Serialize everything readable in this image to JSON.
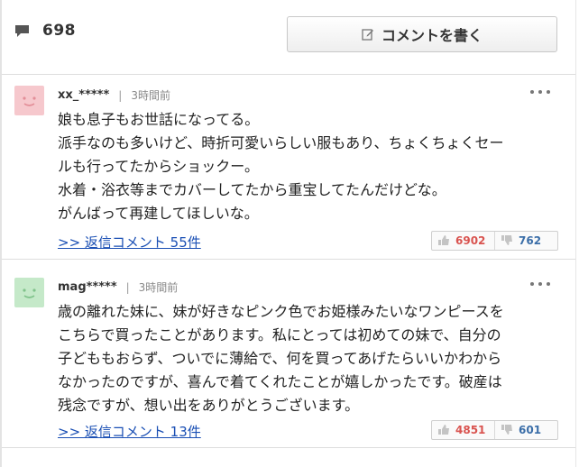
{
  "header": {
    "comment_count": "698",
    "write_button_label": "コメントを書く"
  },
  "comments": [
    {
      "user": "xx_*****",
      "separator": "|",
      "time": "3時間前",
      "avatar_color": "#f6c8cd",
      "lines": [
        "娘も息子もお世話になってる。",
        "派手なのも多いけど、時折可愛いらしい服もあり、ちょくちょくセー",
        "ルも行ってたからショックー。",
        "水着・浴衣等までカバーしてたから重宝してたんだけどな。",
        "がんばって再建してほしいな。"
      ],
      "reply_link": ">> 返信コメント 55件",
      "likes": "6902",
      "dislikes": "762"
    },
    {
      "user": "mag*****",
      "separator": "|",
      "time": "3時間前",
      "avatar_color": "#c5e9c9",
      "lines": [
        "歳の離れた妹に、妹が好きなピンク色でお姫様みたいなワンピースを",
        "こちらで買ったことがあります。私にとっては初めての妹で、自分の",
        "子どももおらず、ついでに薄給で、何を買ってあげたらいいかわから",
        "なかったのですが、喜んで着てくれたことが嬉しかったです。破産は",
        "残念ですが、想い出をありがとうございます。"
      ],
      "reply_link": ">> 返信コメント 13件",
      "likes": "4851",
      "dislikes": "601"
    }
  ],
  "icons": {
    "count": "speech-bubble-icon",
    "write": "pencil-icon",
    "like": "thumbs-up-icon",
    "dislike": "thumbs-down-icon",
    "more": "more-dots-icon"
  },
  "colors": {
    "like": "#d9534f",
    "dislike": "#3b6ea8",
    "link": "#1a4fb4"
  }
}
